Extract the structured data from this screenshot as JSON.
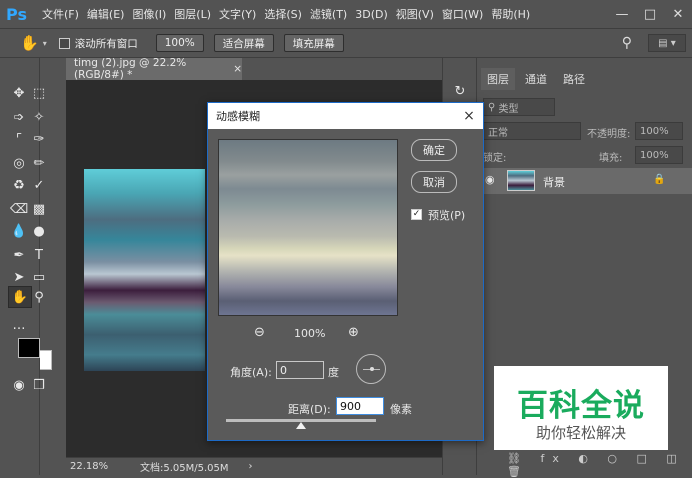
{
  "app": {
    "logo": "Ps",
    "menu": [
      "文件(F)",
      "编辑(E)",
      "图像(I)",
      "图层(L)",
      "文字(Y)",
      "选择(S)",
      "滤镜(T)",
      "3D(D)",
      "视图(V)",
      "窗口(W)",
      "帮助(H)"
    ],
    "window_controls": [
      "minimize-icon",
      "maximize-icon",
      "close-icon"
    ]
  },
  "options_bar": {
    "scroll_all_label": "滚动所有窗口",
    "zoom_100_label": "100%",
    "fit_screen_label": "适合屏幕",
    "fill_screen_label": "填充屏幕"
  },
  "document": {
    "tab_title": "timg (2).jpg @ 22.2%(RGB/8#) *",
    "tab_close": "×",
    "zoom": "22.18%",
    "doc_info": "文档:5.05M/5.05M",
    "status_arrow": "›"
  },
  "layers_panel": {
    "tabs": [
      "图层",
      "通道",
      "路径"
    ],
    "filter_kind": "类型",
    "blend_mode": "正常",
    "opacity_label": "不透明度:",
    "opacity_value": "100%",
    "lock_label": "锁定:",
    "fill_label": "填充:",
    "fill_value": "100%",
    "layer_name": "背景"
  },
  "dialog": {
    "title": "动感模糊",
    "close": "×",
    "ok_label": "确定",
    "cancel_label": "取消",
    "preview_label": "预览(P)",
    "preview_checked": true,
    "zoom_level": "100%",
    "angle_label": "角度(A):",
    "angle_value": "0",
    "angle_unit": "度",
    "distance_label": "距离(D):",
    "distance_value": "900",
    "distance_unit": "像素",
    "distance_slider_fraction": 0.5
  },
  "watermark": {
    "title": "百科全说",
    "subtitle": "助你轻松解决"
  },
  "colors": {
    "ui_bg": "#535353",
    "accent_blue": "#31a8ff",
    "watermark_green": "#1aab5d"
  }
}
